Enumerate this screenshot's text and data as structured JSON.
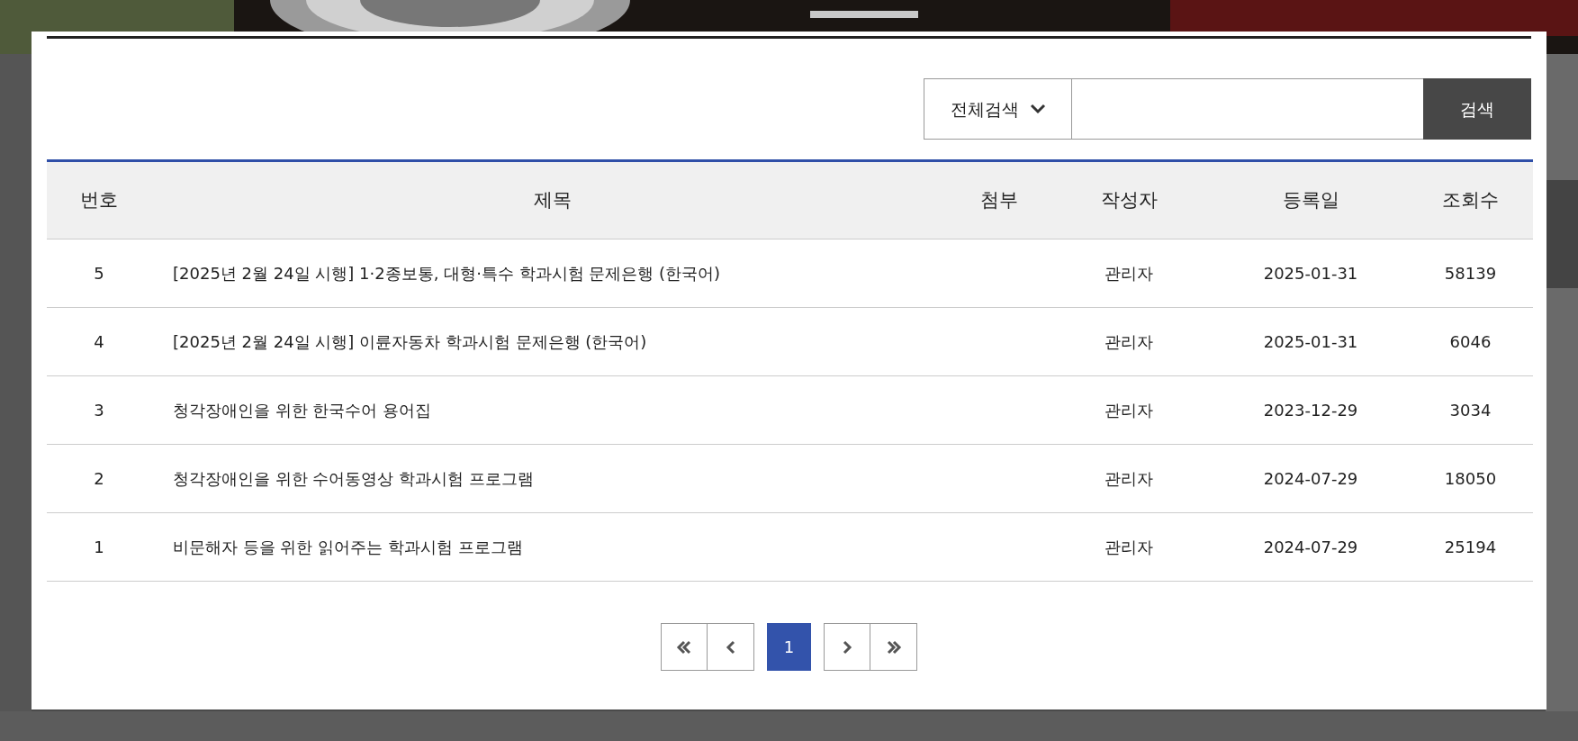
{
  "search": {
    "scope": "전체검색",
    "button": "검색"
  },
  "table": {
    "columns": [
      "번호",
      "제목",
      "첨부",
      "작성자",
      "등록일",
      "조회수"
    ],
    "rows": [
      {
        "number": "5",
        "title": "[2025년 2월 24일 시행] 1·2종보통, 대형·특수 학과시험 문제은행 (한국어)",
        "author": "관리자",
        "date": "2025-01-31",
        "views": "58139"
      },
      {
        "number": "4",
        "title": "[2025년 2월 24일 시행] 이륜자동차 학과시험 문제은행 (한국어)",
        "author": "관리자",
        "date": "2025-01-31",
        "views": "6046"
      },
      {
        "number": "3",
        "title": "청각장애인을 위한 한국수어 용어집",
        "author": "관리자",
        "date": "2023-12-29",
        "views": "3034"
      },
      {
        "number": "2",
        "title": "청각장애인을 위한 수어동영상 학과시험 프로그램",
        "author": "관리자",
        "date": "2024-07-29",
        "views": "18050"
      },
      {
        "number": "1",
        "title": "비문해자 등을 위한 읽어주는 학과시험 프로그램",
        "author": "관리자",
        "date": "2024-07-29",
        "views": "25194"
      }
    ]
  },
  "pagination": {
    "pages": [
      {
        "label": "1",
        "selected": true
      }
    ]
  }
}
